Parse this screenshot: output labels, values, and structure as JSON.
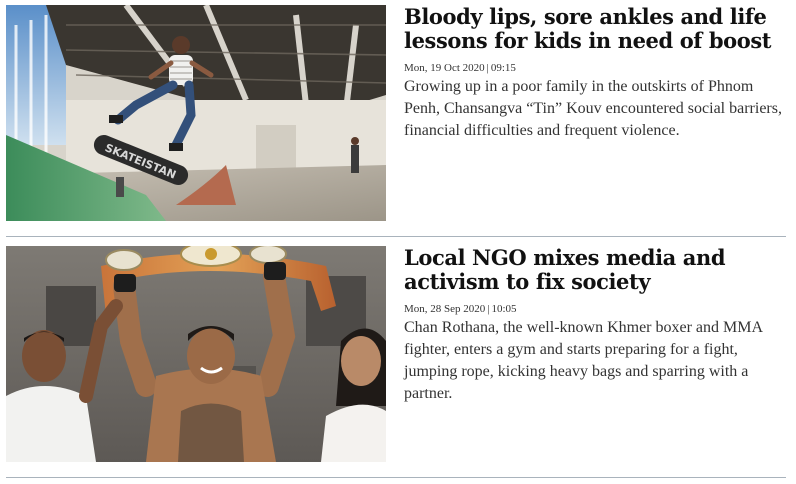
{
  "articles": [
    {
      "headline": "Bloody lips, sore ankles and life lessons for kids in need of boost",
      "date": "Mon, 19 Oct 2020",
      "time": "09:15",
      "excerpt": "Growing up in a poor family in the outskirts of Phnom Penh, Chansangva “Tin” Kouv encountered social barriers, financial difficulties and frequent violence.",
      "image_caption_text": "SKATEISTAN",
      "image_icon": "skateboarder-photo"
    },
    {
      "headline": "Local NGO mixes media and activism to fix society",
      "date": "Mon, 28 Sep 2020",
      "time": "10:05",
      "excerpt": "Chan Rothana, the well-known Khmer boxer and MMA fighter, enters a gym and starts preparing for a fight, jumping rope, kicking heavy bags and sparring with a partner.",
      "image_icon": "boxer-with-belt-photo"
    }
  ],
  "meta_separator": "|"
}
